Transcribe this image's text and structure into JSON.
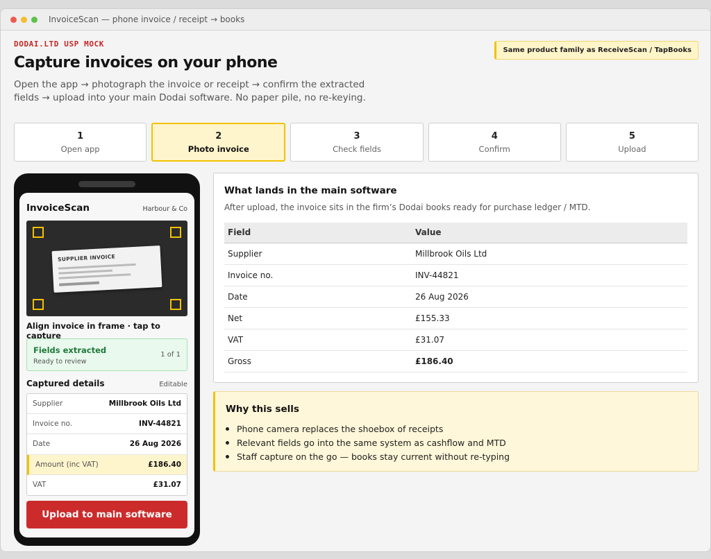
{
  "window": {
    "title": "InvoiceScan — phone invoice / receipt → books"
  },
  "hero": {
    "eyebrow": "DODAI.LTD USP MOCK",
    "headline": "Capture invoices on your phone",
    "subhead": "Open the app → photograph the invoice or receipt → confirm the extracted fields → upload into your main Dodai software. No paper pile, no re-keying.",
    "family_badge": "Same product family as ReceiveScan / TapBooks"
  },
  "steps": [
    {
      "num": "1",
      "label": "Open app",
      "active": false
    },
    {
      "num": "2",
      "label": "Photo invoice",
      "active": true
    },
    {
      "num": "3",
      "label": "Check fields",
      "active": false
    },
    {
      "num": "4",
      "label": "Confirm",
      "active": false
    },
    {
      "num": "5",
      "label": "Upload",
      "active": false
    }
  ],
  "phone": {
    "app_title": "InvoiceScan",
    "firm": "Harbour & Co",
    "paper_title": "SUPPLIER INVOICE",
    "capture_hint": "Align invoice in frame · tap to capture",
    "fields_status": {
      "title": "Fields extracted",
      "subtitle": "Ready to review",
      "count": "1 of 1"
    },
    "details": {
      "title": "Captured details",
      "edit_label": "Editable",
      "rows": [
        {
          "label": "Supplier",
          "value": "Millbrook Oils Ltd"
        },
        {
          "label": "Invoice no.",
          "value": "INV-44821"
        },
        {
          "label": "Date",
          "value": "26 Aug 2026"
        },
        {
          "label": "Amount (inc VAT)",
          "value": "£186.40"
        },
        {
          "label": "VAT",
          "value": "£31.07"
        }
      ]
    },
    "upload_button": "Upload to main software"
  },
  "main_software": {
    "title": "What lands in the main software",
    "subtitle": "After upload, the invoice sits in the firm’s Dodai books ready for purchase ledger / MTD.",
    "columns": [
      "Field",
      "Value"
    ],
    "rows": [
      {
        "field": "Supplier",
        "value": "Millbrook Oils Ltd"
      },
      {
        "field": "Invoice no.",
        "value": "INV-44821"
      },
      {
        "field": "Date",
        "value": "26 Aug 2026"
      },
      {
        "field": "Net",
        "value": "£155.33"
      },
      {
        "field": "VAT",
        "value": "£31.07"
      },
      {
        "field": "Gross",
        "value": "£186.40"
      }
    ]
  },
  "why": {
    "title": "Why this sells",
    "points": [
      "Phone camera replaces the shoebox of receipts",
      "Relevant fields go into the same system as cashflow and MTD",
      "Staff capture on the go — books stay current without re-typing"
    ]
  },
  "colors": {
    "accent_red": "#cc2b2b",
    "highlight_yellow": "#f2c200",
    "success_green": "#1e7a3a"
  }
}
